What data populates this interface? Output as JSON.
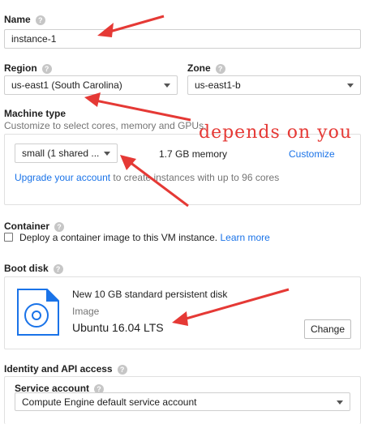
{
  "name": {
    "label": "Name",
    "value": "instance-1"
  },
  "region": {
    "label": "Region",
    "value": "us-east1 (South Carolina)"
  },
  "zone": {
    "label": "Zone",
    "value": "us-east1-b"
  },
  "machine": {
    "label": "Machine type",
    "subtitle": "Customize to select cores, memory and GPUs.",
    "selected": "small (1 shared ...",
    "memory": "1.7 GB memory",
    "customize": "Customize",
    "upgrade_link": "Upgrade your account",
    "upgrade_rest": " to create instances with up to 96 cores"
  },
  "container": {
    "label": "Container",
    "checkbox_text": "Deploy a container image to this VM instance.",
    "learn_more": "Learn more"
  },
  "boot": {
    "label": "Boot disk",
    "disk_desc": "New 10 GB standard persistent disk",
    "image_label": "Image",
    "image_value": "Ubuntu 16.04 LTS",
    "change": "Change"
  },
  "identity": {
    "label": "Identity and API access",
    "service_label": "Service account",
    "service_value": "Compute Engine default service account"
  },
  "annotation": "depends on you",
  "colors": {
    "annotation_red": "#e53935",
    "link_blue": "#1a73e8"
  },
  "icons": {
    "help": "help-circle-icon",
    "disk": "disk-icon",
    "caret": "dropdown-caret-icon"
  }
}
